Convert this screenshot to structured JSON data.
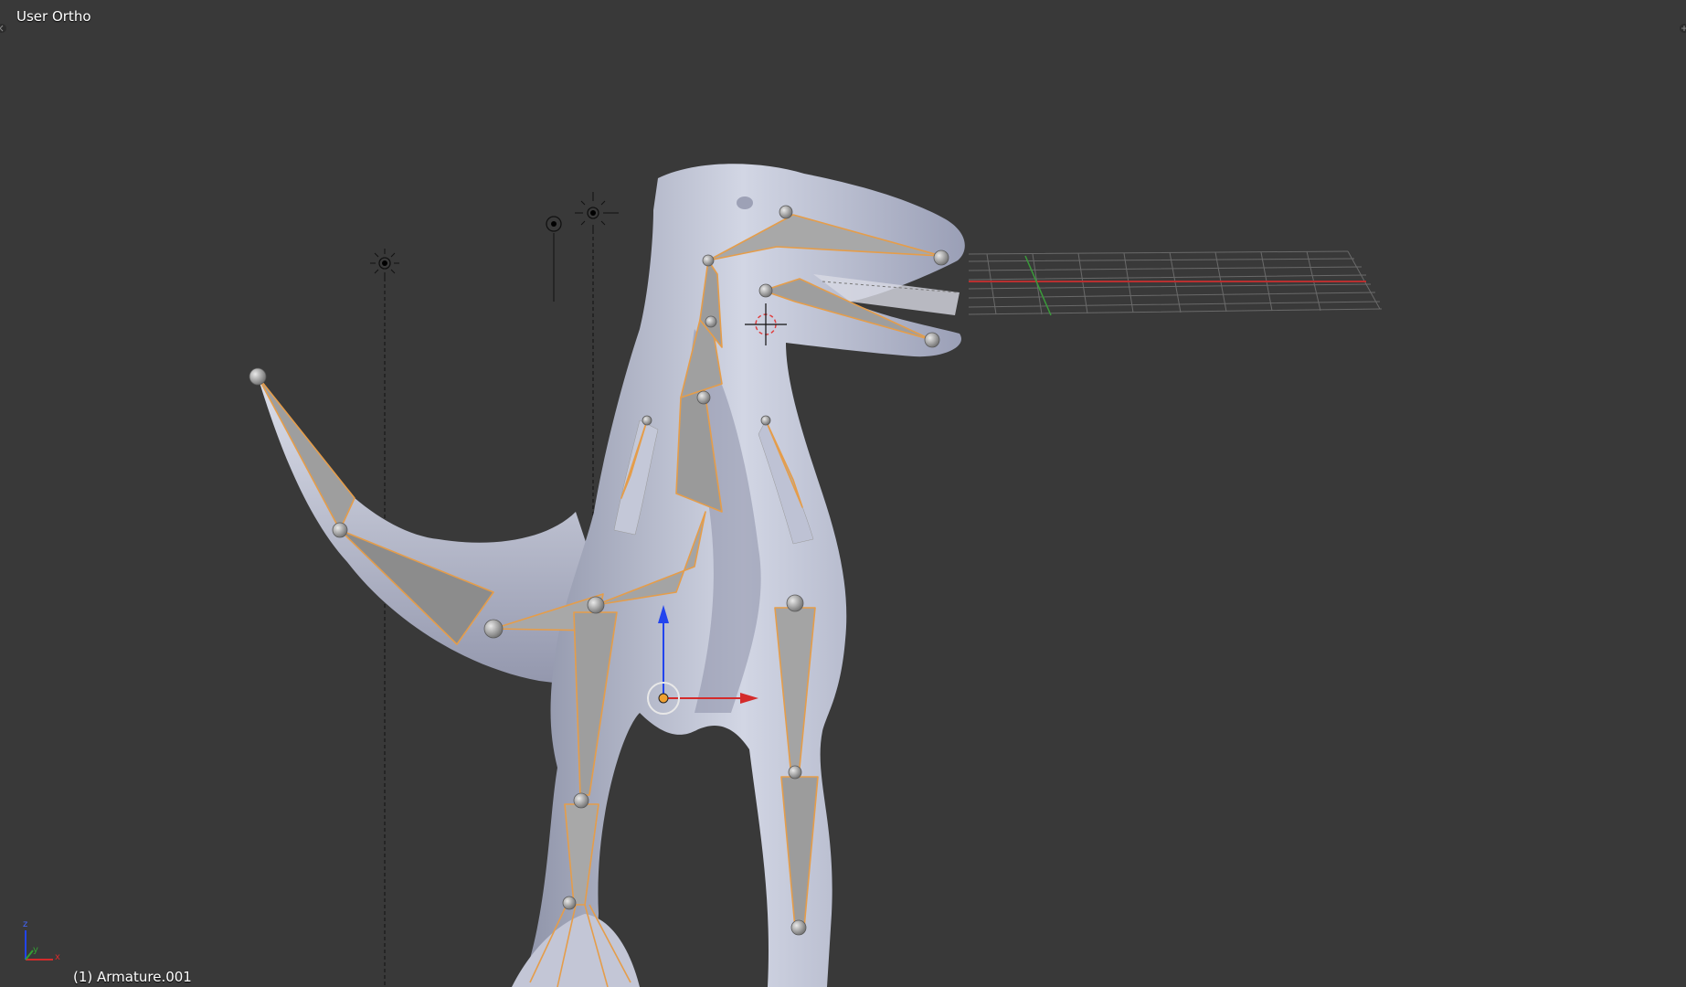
{
  "viewport": {
    "view_name": "User Ortho",
    "active_object": "(1) Armature.001",
    "background": "#393939"
  },
  "mini_axis": {
    "x": "x",
    "y": "y",
    "z": "z"
  },
  "colors": {
    "bone_outline": "#e59d4a",
    "mesh": "#b4b9cf",
    "axis_x": "#d42b2b",
    "axis_y": "#33a033",
    "axis_z": "#2244ee"
  },
  "icons": [
    "lamp-icon",
    "manipulator-widget",
    "3d-cursor-icon",
    "view-axis-gizmo",
    "area-split-corner-icon"
  ]
}
